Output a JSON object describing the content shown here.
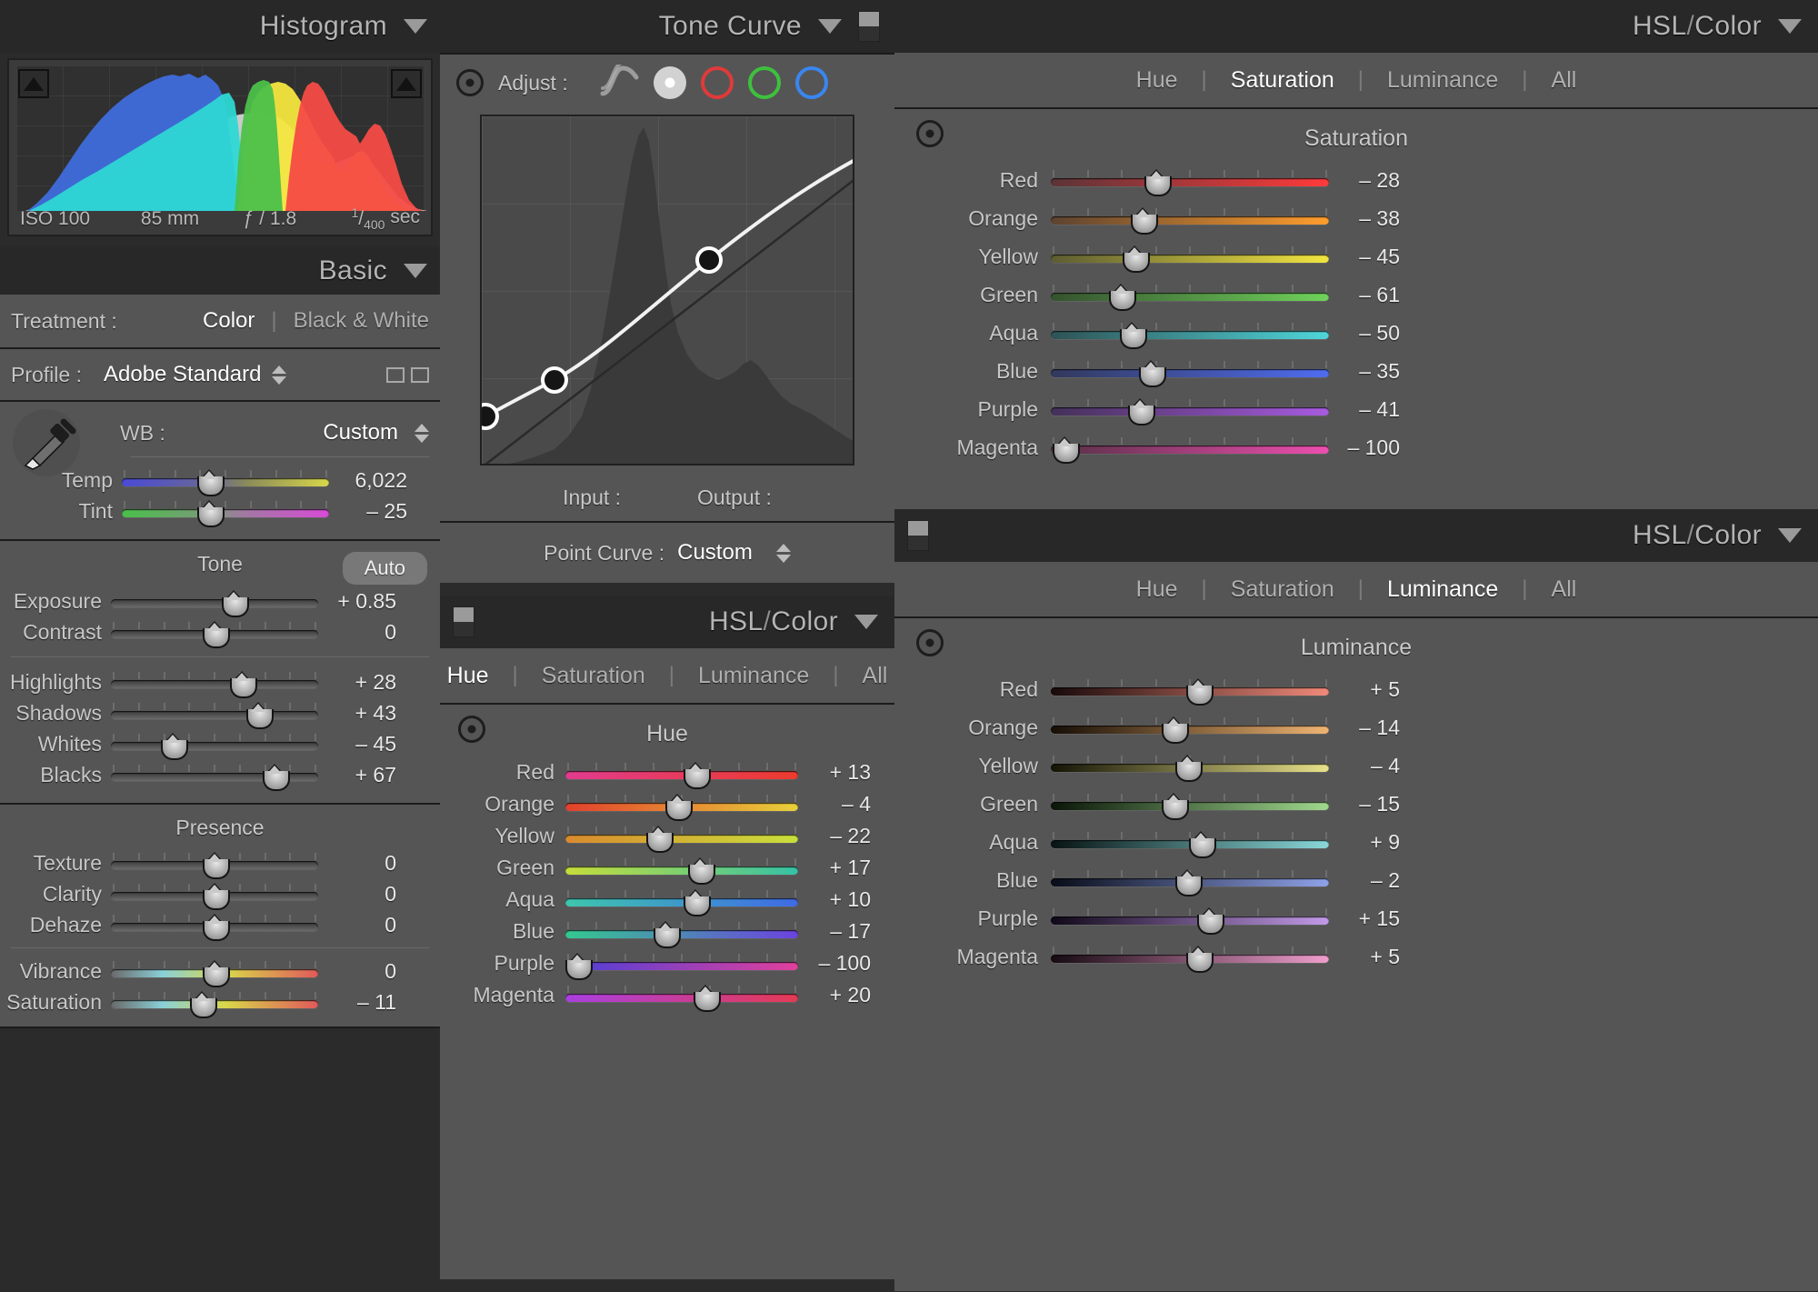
{
  "histogram": {
    "title": "Histogram",
    "iso": "ISO 100",
    "focal": "85 mm",
    "aperture": "ƒ / 1.8",
    "shutter_num": "1",
    "shutter_den": "400",
    "shutter_unit": "sec",
    "clip_left_icon": "shadow-clipping-icon",
    "clip_right_icon": "highlight-clipping-icon"
  },
  "basic": {
    "title": "Basic",
    "treatment_label": "Treatment :",
    "treatment_options": [
      "Color",
      "Black & White"
    ],
    "treatment_selected": "Color",
    "profile_label": "Profile :",
    "profile_value": "Adobe Standard",
    "wb_label": "WB :",
    "wb_value": "Custom",
    "wb_sliders": [
      {
        "label": "Temp",
        "value": "6,022",
        "pos": 42
      },
      {
        "label": "Tint",
        "value": "– 25",
        "pos": 42
      }
    ],
    "tone_title": "Tone",
    "auto_label": "Auto",
    "tone_sliders": [
      {
        "label": "Exposure",
        "value": "+ 0.85",
        "pos": 59
      },
      {
        "label": "Contrast",
        "value": "0",
        "pos": 50
      }
    ],
    "tone_sliders2": [
      {
        "label": "Highlights",
        "value": "+ 28",
        "pos": 63
      },
      {
        "label": "Shadows",
        "value": "+ 43",
        "pos": 71
      },
      {
        "label": "Whites",
        "value": "– 45",
        "pos": 30
      },
      {
        "label": "Blacks",
        "value": "+ 67",
        "pos": 79
      }
    ],
    "presence_title": "Presence",
    "presence_sliences": [],
    "presence_sliders": [
      {
        "label": "Texture",
        "value": "0",
        "pos": 50
      },
      {
        "label": "Clarity",
        "value": "0",
        "pos": 50
      },
      {
        "label": "Dehaze",
        "value": "0",
        "pos": 50
      }
    ],
    "presence_sliders2": [
      {
        "label": "Vibrance",
        "value": "0",
        "pos": 50
      },
      {
        "label": "Saturation",
        "value": "– 11",
        "pos": 44
      }
    ]
  },
  "tone_curve": {
    "title": "Tone Curve",
    "adjust_label": "Adjust :",
    "channels": [
      "parametric-curve-icon",
      "rgb-white-channel",
      "red-channel",
      "green-channel",
      "blue-channel"
    ],
    "input_label": "Input :",
    "output_label": "Output :",
    "point_curve_label": "Point Curve :",
    "point_curve_value": "Custom"
  },
  "hsl_saturation": {
    "title_main": "HSL",
    "title_slash": "/",
    "title_sub": "Color",
    "tabs": [
      "Hue",
      "Saturation",
      "Luminance",
      "All"
    ],
    "active_tab": "Saturation",
    "subtitle": "Saturation",
    "sliders": [
      {
        "label": "Red",
        "value": "– 28",
        "pos": 38,
        "c1": "#5b3438",
        "c2": "#ff3b3b"
      },
      {
        "label": "Orange",
        "value": "– 38",
        "pos": 33,
        "c1": "#5c4330",
        "c2": "#ff9d2e"
      },
      {
        "label": "Yellow",
        "value": "– 45",
        "pos": 30,
        "c1": "#5c5c33",
        "c2": "#f2e541"
      },
      {
        "label": "Green",
        "value": "– 61",
        "pos": 25,
        "c1": "#35522f",
        "c2": "#6fd25a"
      },
      {
        "label": "Aqua",
        "value": "– 50",
        "pos": 29,
        "c1": "#2f5255",
        "c2": "#4fd6da"
      },
      {
        "label": "Blue",
        "value": "– 35",
        "pos": 36,
        "c1": "#32395c",
        "c2": "#4f6cf0"
      },
      {
        "label": "Purple",
        "value": "– 41",
        "pos": 32,
        "c1": "#443058",
        "c2": "#a85be0"
      },
      {
        "label": "Magenta",
        "value": "– 100",
        "pos": 5,
        "c1": "#553045",
        "c2": "#ee4fb0"
      }
    ]
  },
  "hsl_hue": {
    "title_main": "HSL",
    "title_slash": "/",
    "title_sub": "Color",
    "tabs": [
      "Hue",
      "Saturation",
      "Luminance",
      "All"
    ],
    "active_tab": "Hue",
    "subtitle": "Hue",
    "sliders": [
      {
        "label": "Red",
        "value": "+ 13",
        "pos": 56,
        "c1": "#e23b8e",
        "c2": "#ec3b2d"
      },
      {
        "label": "Orange",
        "value": "– 4",
        "pos": 48,
        "c1": "#e2402c",
        "c2": "#e8d13a"
      },
      {
        "label": "Yellow",
        "value": "– 22",
        "pos": 40,
        "c1": "#d98a2e",
        "c2": "#c9e03c"
      },
      {
        "label": "Green",
        "value": "+ 17",
        "pos": 58,
        "c1": "#c6dd3a",
        "c2": "#35c2a6"
      },
      {
        "label": "Aqua",
        "value": "+ 10",
        "pos": 56,
        "c1": "#3ec7ac",
        "c2": "#3f6ae6"
      },
      {
        "label": "Blue",
        "value": "– 17",
        "pos": 43,
        "c1": "#34c98f",
        "c2": "#6c42e0"
      },
      {
        "label": "Purple",
        "value": "– 100",
        "pos": 5,
        "c1": "#4b3fd8",
        "c2": "#e2409b"
      },
      {
        "label": "Magenta",
        "value": "+ 20",
        "pos": 60,
        "c1": "#a93fe0",
        "c2": "#e53a54"
      }
    ]
  },
  "hsl_luminance": {
    "title_main": "HSL",
    "title_slash": "/",
    "title_sub": "Color",
    "tabs": [
      "Hue",
      "Saturation",
      "Luminance",
      "All"
    ],
    "active_tab": "Luminance",
    "subtitle": "Luminance",
    "sliders": [
      {
        "label": "Red",
        "value": "+ 5",
        "pos": 53,
        "c1": "#180a0a",
        "c2": "#f08a7a"
      },
      {
        "label": "Orange",
        "value": "– 14",
        "pos": 44,
        "c1": "#160e06",
        "c2": "#f0b472"
      },
      {
        "label": "Yellow",
        "value": "– 4",
        "pos": 49,
        "c1": "#141406",
        "c2": "#e8e28a"
      },
      {
        "label": "Green",
        "value": "– 15",
        "pos": 44,
        "c1": "#0a1608",
        "c2": "#9fd98e"
      },
      {
        "label": "Aqua",
        "value": "+ 9",
        "pos": 54,
        "c1": "#081414",
        "c2": "#8ad8da"
      },
      {
        "label": "Blue",
        "value": "– 2",
        "pos": 49,
        "c1": "#080c18",
        "c2": "#8fa2e8"
      },
      {
        "label": "Purple",
        "value": "+ 15",
        "pos": 57,
        "c1": "#100818",
        "c2": "#c29ae8"
      },
      {
        "label": "Magenta",
        "value": "+ 5",
        "pos": 53,
        "c1": "#160a12",
        "c2": "#ef9ecd"
      }
    ]
  }
}
